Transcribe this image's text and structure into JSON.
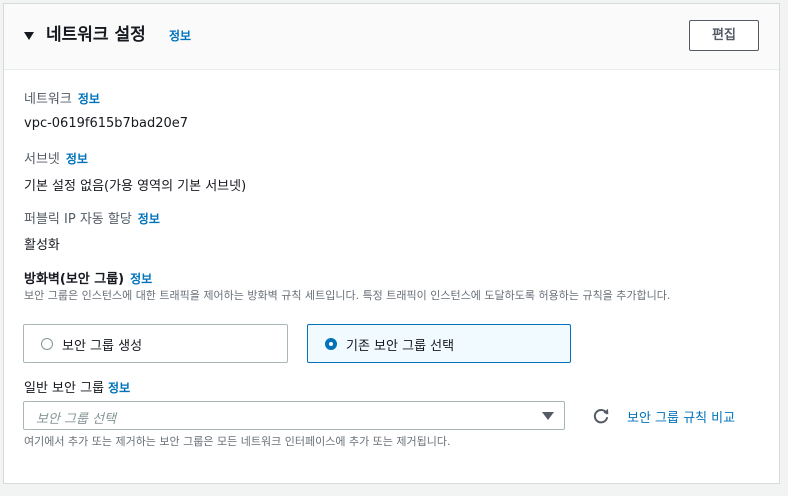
{
  "header": {
    "title": "네트워크 설정",
    "info": "정보",
    "edit_label": "편집"
  },
  "network": {
    "label": "네트워크",
    "info": "정보",
    "value": "vpc-0619f615b7bad20e7"
  },
  "subnet": {
    "label": "서브넷",
    "info": "정보",
    "value": "기본 설정 없음(가용 영역의 기본 서브넷)"
  },
  "public_ip": {
    "label": "퍼블릭 IP 자동 할당",
    "info": "정보",
    "value": "활성화"
  },
  "firewall": {
    "label": "방화벽(보안 그룹)",
    "info": "정보",
    "description": "보안 그룹은 인스턴스에 대한 트래픽을 제어하는 방화벽 규칙 세트입니다. 특정 트래픽이 인스턴스에 도달하도록 허용하는 규칙을 추가합니다.",
    "options": [
      {
        "label": "보안 그룹 생성",
        "selected": false
      },
      {
        "label": "기존 보안 그룹 선택",
        "selected": true
      }
    ]
  },
  "security_group": {
    "label": "일반 보안 그룹",
    "info": "정보",
    "placeholder": "보안 그룹 선택",
    "compare_label": "보안 그룹 규칙 비교",
    "hint": "여기에서 추가 또는 제거하는 보안 그룹은 모든 네트워크 인터페이스에 추가 또는 제거됩니다."
  },
  "icons": {
    "caret": "caret-down-icon",
    "refresh": "refresh-icon",
    "select_caret": "caret-down-icon"
  },
  "colors": {
    "link": "#0073bb",
    "text": "#16191f",
    "secondary": "#545b64",
    "border": "#aab7b8"
  }
}
